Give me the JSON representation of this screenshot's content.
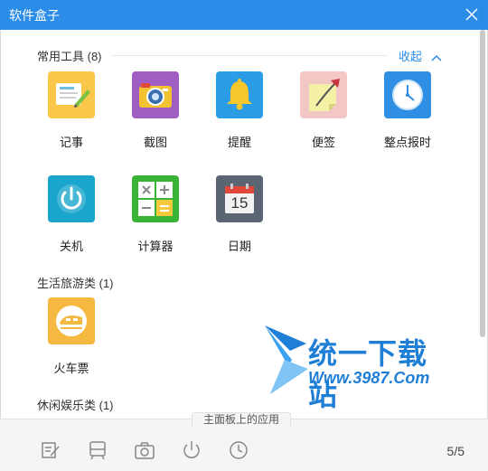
{
  "window": {
    "title": "软件盒子"
  },
  "sections": {
    "common": {
      "title": "常用工具 (8)",
      "collapse_label": "收起"
    },
    "travel": {
      "title": "生活旅游类 (1)"
    },
    "leisure": {
      "title": "休闲娱乐类 (1)"
    }
  },
  "tools": {
    "notes": {
      "label": "记事",
      "icon": "notes-icon",
      "color": "#f9c84a"
    },
    "screenshot": {
      "label": "截图",
      "icon": "camera-icon",
      "color": "#a05ec3"
    },
    "reminder": {
      "label": "提醒",
      "icon": "bell-icon",
      "color": "#2a9de6"
    },
    "sticky": {
      "label": "便签",
      "icon": "sticky-note-icon",
      "color": "#f3c7c5"
    },
    "hourly": {
      "label": "整点报时",
      "icon": "clock-icon",
      "color": "#2f8fe4"
    },
    "shutdown": {
      "label": "关机",
      "icon": "power-icon",
      "color": "#1aa5cc"
    },
    "calculator": {
      "label": "计算器",
      "icon": "calculator-icon",
      "color": "#3bb339"
    },
    "date": {
      "label": "日期",
      "icon": "calendar-icon",
      "color": "#5a6472",
      "day": "15"
    },
    "train": {
      "label": "火车票",
      "icon": "train-icon",
      "color": "#f5b840"
    }
  },
  "watermark": {
    "text": "统一下载站",
    "url": "Www.3987.Com"
  },
  "bottom_bar": {
    "label": "主面板上的应用",
    "icons": [
      "notes-icon",
      "train-icon",
      "camera-icon",
      "power-icon",
      "clock-icon"
    ],
    "pager": "5/5"
  }
}
